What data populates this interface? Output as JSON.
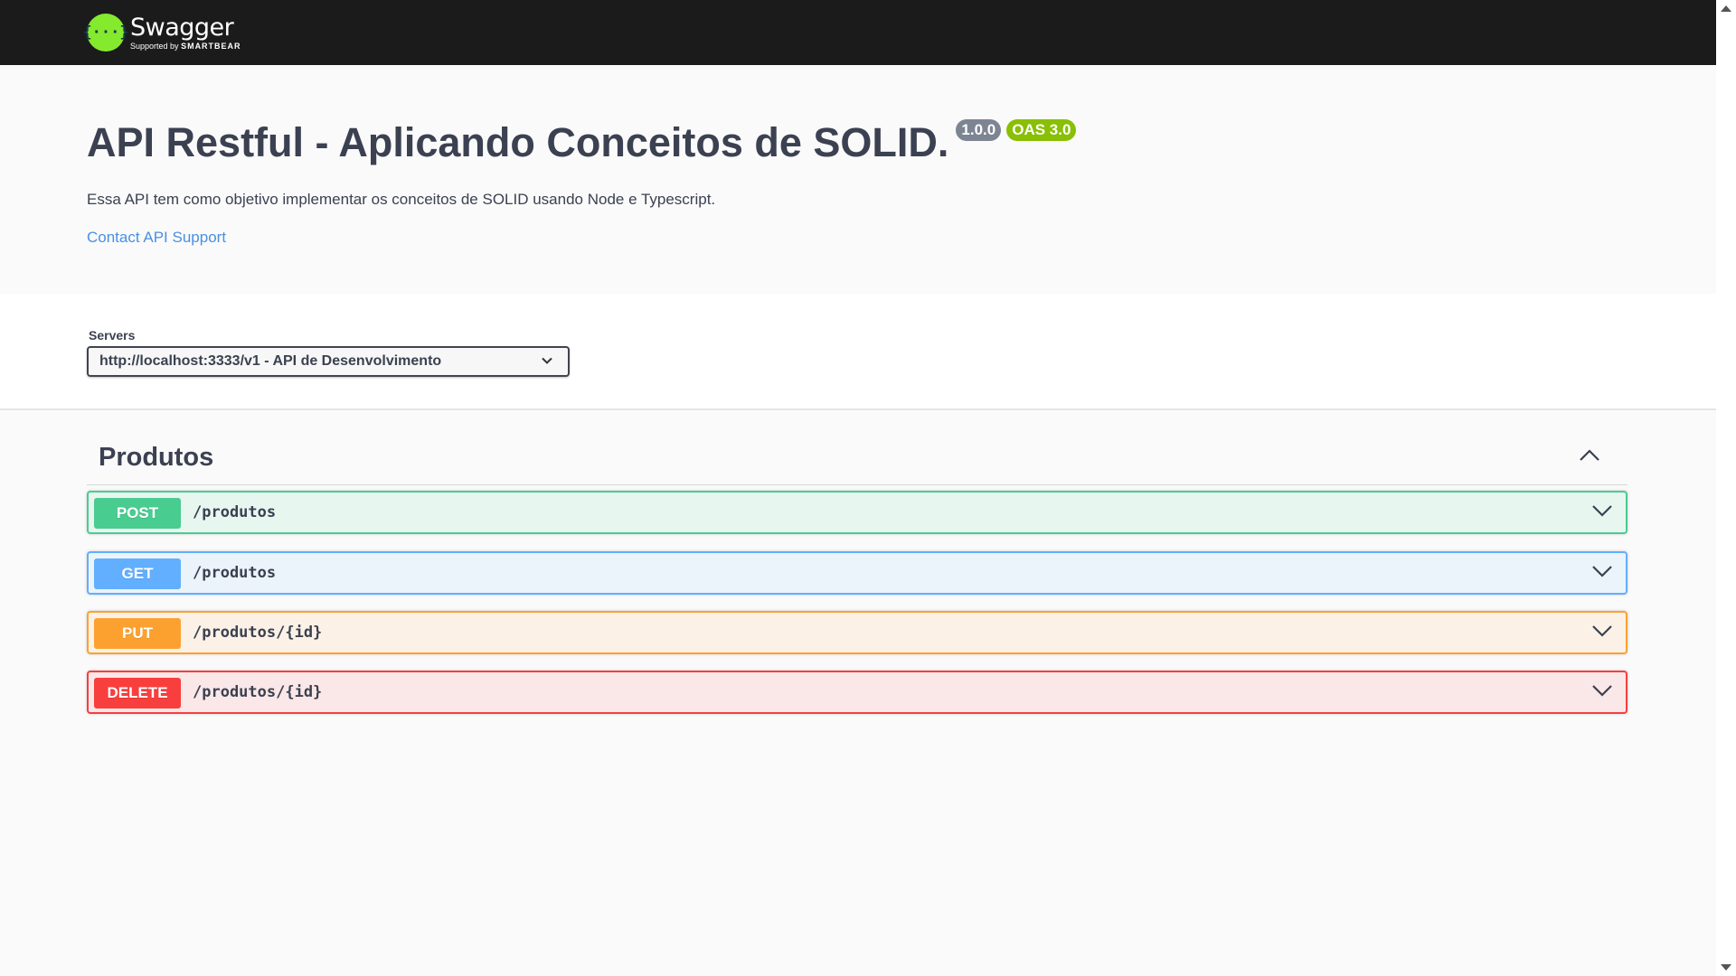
{
  "topbar": {
    "logo_glyph": "{···}",
    "logo_name": "Swagger",
    "logo_sub_prefix": "Supported by",
    "logo_sub_brand": "SMARTBEAR"
  },
  "info": {
    "title": "API Restful - Aplicando Conceitos de SOLID.",
    "version_badge": "1.0.0",
    "oas_badge": "OAS 3.0",
    "description": "Essa API tem como objetivo implementar os conceitos de SOLID usando Node e Typescript.",
    "contact_link": "Contact API Support"
  },
  "servers": {
    "label": "Servers",
    "selected": "http://localhost:3333/v1 - API de Desenvolvimento"
  },
  "tag": {
    "title": "Produtos",
    "expanded": true
  },
  "operations": [
    {
      "method": "POST",
      "path": "/produtos",
      "color": "#49cc90"
    },
    {
      "method": "GET",
      "path": "/produtos",
      "color": "#61affe"
    },
    {
      "method": "PUT",
      "path": "/produtos/{id}",
      "color": "#fca130"
    },
    {
      "method": "DELETE",
      "path": "/produtos/{id}",
      "color": "#f93e3e"
    }
  ],
  "colors": {
    "topbar_bg": "#1b1b1b",
    "logo_green": "#85ea2d",
    "link": "#4990e2",
    "badge_version": "#7d8492",
    "badge_oas": "#89bf04"
  }
}
